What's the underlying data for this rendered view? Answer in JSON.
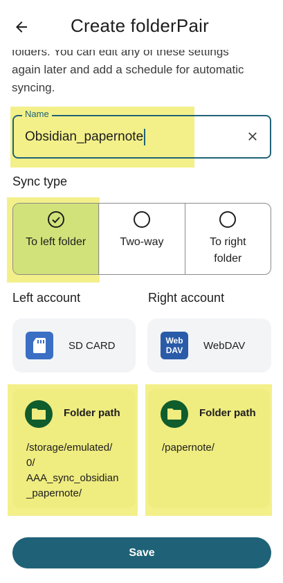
{
  "header": {
    "title": "Create folderPair",
    "back_icon": "arrow-left-icon"
  },
  "intro": {
    "line1": "folders. You can edit any of these settings",
    "line2": "again later and add a schedule for automatic",
    "line3": "syncing."
  },
  "name_field": {
    "label": "Name",
    "value": "Obsidian_papernote",
    "clear_icon": "close-icon"
  },
  "sync_type": {
    "label": "Sync type",
    "options": [
      {
        "line1": "To left folder",
        "line2": "",
        "icon": "check-circle-icon",
        "selected": true
      },
      {
        "line1": "Two-way",
        "line2": "",
        "icon": "radio-empty-icon",
        "selected": false
      },
      {
        "line1": "To right",
        "line2": "folder",
        "icon": "radio-empty-icon",
        "selected": false
      }
    ]
  },
  "left_account": {
    "label": "Left account",
    "card_label": "SD CARD",
    "icon": "sd-card-icon",
    "icon_color": "#3a6fc4"
  },
  "right_account": {
    "label": "Right account",
    "card_label": "WebDAV",
    "icon_line1": "Web",
    "icon_line2": "DAV",
    "icon_color": "#2a5ba8"
  },
  "left_folder": {
    "title": "Folder path",
    "path": "/storage/emulated/0/AAA_sync_obsidian_papernote/",
    "path_lines": [
      "/storage/emulated/",
      "0/",
      "AAA_sync_obsidian",
      "_papernote/"
    ],
    "icon": "folder-icon"
  },
  "right_folder": {
    "title": "Folder path",
    "path": "/papernote/",
    "icon": "folder-icon"
  },
  "save_button": {
    "label": "Save"
  },
  "colors": {
    "accent": "#1f6277",
    "selected_segment": "#d2e27a",
    "highlight": "#f3f08a",
    "folder_icon_bg": "#0f5c2d"
  }
}
